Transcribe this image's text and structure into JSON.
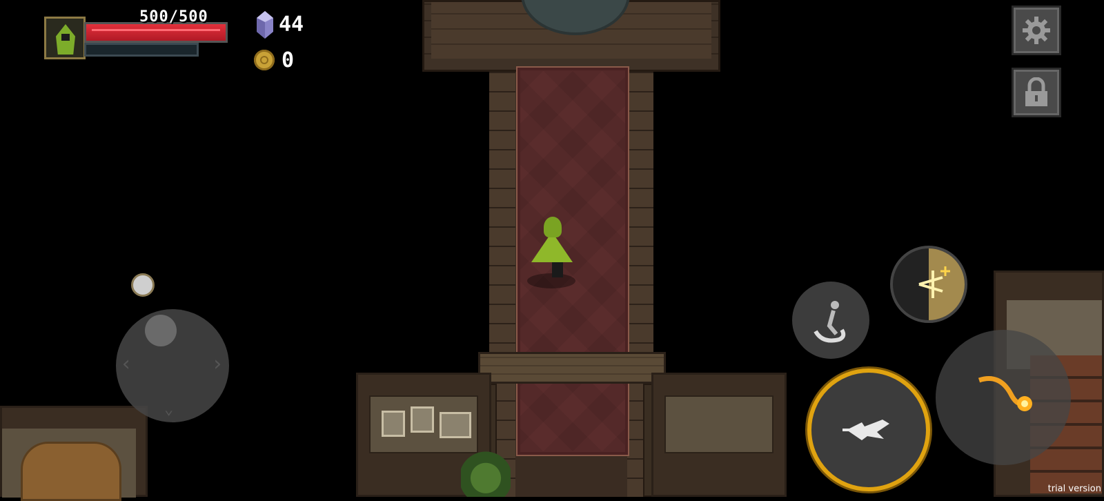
{
  "hud": {
    "hp_text": "500/500",
    "hp_fraction": 1.0,
    "gems": "44",
    "gold": "0"
  },
  "buttons": {
    "settings": "gear-icon",
    "lock": "lock-icon",
    "dash": "dash-icon",
    "skill": "arcane-burst-icon",
    "attack": "basic-attack-icon",
    "signature": "fireball-icon"
  },
  "footer": {
    "trial": "trial version"
  },
  "colors": {
    "hp": "#d8232e",
    "accent_gold": "#e0a310",
    "hero_cloak": "#8fb82a"
  }
}
